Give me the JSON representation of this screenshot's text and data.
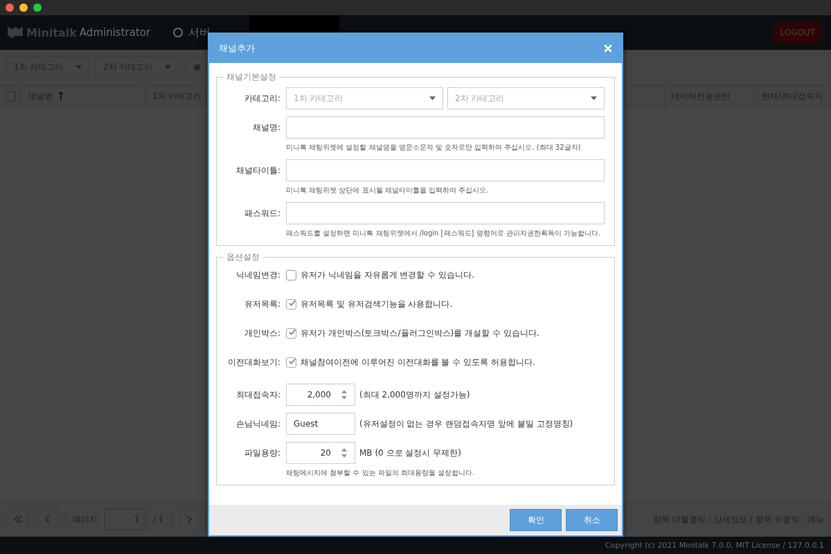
{
  "header": {
    "logo_bold": "Minitalk",
    "logo_light": "Administrator",
    "logout": "LOGOUT",
    "nav": [
      {
        "label": "서버",
        "selected": false
      },
      {
        "selected": true
      },
      {
        "selected": false
      },
      {
        "selected": false
      },
      {
        "selected": false
      },
      {
        "selected": false
      }
    ]
  },
  "toolbar": {
    "filters": [
      {
        "placeholder": "1차 카테고리"
      },
      {
        "placeholder": "2차 카테고리"
      }
    ]
  },
  "grid": {
    "select_all_checked": false,
    "columns": [
      "채널명",
      "1차 카테고리",
      "데이터전송권한",
      "현재/최대접속자"
    ]
  },
  "pager": {
    "label": "페이지",
    "page": "1",
    "total": "/ 1",
    "hint": "항목 더블클릭 : 상세정보 / 항목 우클릭 : 메뉴"
  },
  "copyright": "Copyright (c) 2021 Minitalk 7.0.0, MIT License / 127.0.0.1",
  "dialog": {
    "title": "채널추가",
    "sections": [
      {
        "legend": "채널기본설정",
        "rows": [
          {
            "kind": "selects",
            "label": "카테고리:",
            "selects": [
              {
                "placeholder": "1차 카테고리"
              },
              {
                "placeholder": "2차 카테고리"
              }
            ]
          },
          {
            "kind": "text",
            "label": "채널명:",
            "help": "미니톡 채팅위젯에 설정할 채널명을 영문소문자 및 숫자로만 입력하여 주십시오. (최대 32글자)"
          },
          {
            "kind": "text",
            "label": "채널타이틀:",
            "help": "미니톡 채팅위젯 상단에 표시될 채널타이틀을 입력하여 주십시오."
          },
          {
            "kind": "text",
            "label": "패스워드:",
            "help": "패스워드를 설정하면 미니톡 채팅위젯에서 /login [패스워드] 명령어로 관리자권한획득이 가능합니다."
          }
        ]
      },
      {
        "legend": "옵션설정",
        "rows": [
          {
            "kind": "check",
            "label": "닉네임변경:",
            "checked": false,
            "text": "유저가 닉네임을 자유롭게 변경할 수 있습니다."
          },
          {
            "kind": "check",
            "label": "유저목록:",
            "checked": true,
            "text": "유저목록 및 유저검색기능을 사용합니다."
          },
          {
            "kind": "check",
            "label": "개인박스:",
            "checked": true,
            "text": "유저가 개인박스(토크박스/플러그인박스)를 개설할 수 있습니다."
          },
          {
            "kind": "check",
            "label": "이전대화보기:",
            "checked": true,
            "text": "채널참여이전에 이루어진 이전대화를 볼 수 있도록 허용합니다."
          },
          {
            "kind": "number",
            "label": "최대접속자:",
            "value": "2,000",
            "note": "(최대 2,000명까지 설정가능)"
          },
          {
            "kind": "short",
            "label": "손님닉네임:",
            "value": "Guest",
            "note": "(유저설정이 없는 경우 랜덤접속자명 앞에 붙일 고정명칭)"
          },
          {
            "kind": "number",
            "label": "파일용량:",
            "value": "20",
            "note": "MB (0 으로 설정시 무제한)",
            "help": "채팅메시지에 첨부할 수 있는 파일의 최대용량을 설정합니다."
          }
        ]
      }
    ],
    "buttons": [
      "확인",
      "취소"
    ]
  }
}
